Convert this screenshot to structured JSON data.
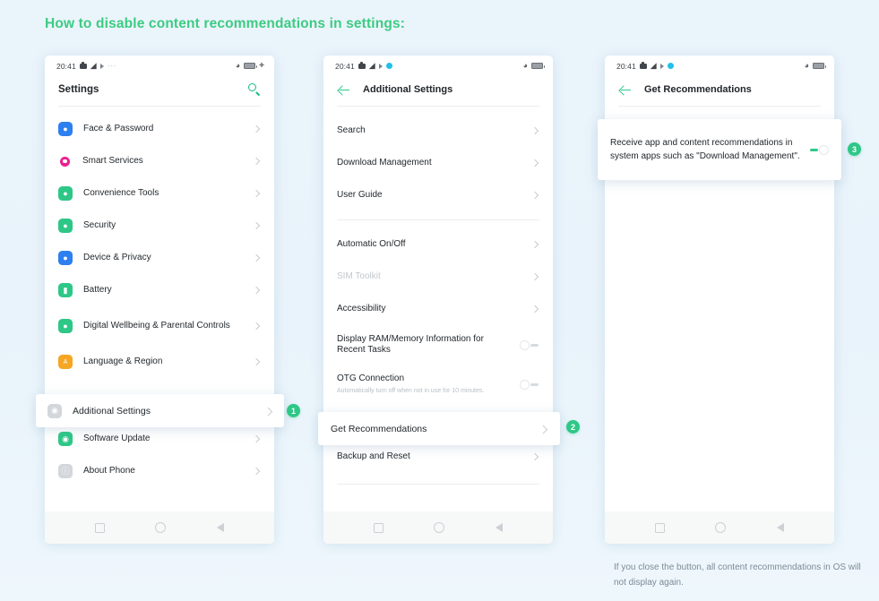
{
  "heading": "How to disable content recommendations in settings:",
  "colors": {
    "accent_green": "#3dcb82",
    "badge_green": "#2ec787",
    "background": "#eaf4fb",
    "toggle_on": "#2fc98c"
  },
  "phones": [
    {
      "id": "settings",
      "statusbar": {
        "time": "20:41",
        "icons_left": [
          "camera-icon",
          "wifi-icon",
          "play-icon",
          "dots-icon"
        ],
        "icons_right": [
          "vibrate-icon",
          "battery-icon",
          "plus-icon"
        ]
      },
      "appbar": {
        "title": "Settings",
        "has_back": false,
        "search_icon": "search-icon"
      },
      "rows": [
        {
          "label": "Face & Password",
          "icon": "face-password-icon",
          "icon_color": "#2e7ff0",
          "glyph": "●",
          "type": "chevron"
        },
        {
          "label": "Smart Services",
          "icon": "smart-services-icon",
          "icon_color": "#e8218f",
          "glyph": "",
          "type": "chevron",
          "shape": "circle"
        },
        {
          "label": "Convenience Tools",
          "icon": "convenience-tools-icon",
          "icon_color": "#2ec787",
          "glyph": "●",
          "type": "chevron"
        },
        {
          "label": "Security",
          "icon": "security-icon",
          "icon_color": "#2ec787",
          "glyph": "●",
          "type": "chevron"
        },
        {
          "label": "Device & Privacy",
          "icon": "device-privacy-icon",
          "icon_color": "#2e7ff0",
          "glyph": "●",
          "type": "chevron"
        },
        {
          "label": "Battery",
          "icon": "battery-icon",
          "icon_color": "#2ec787",
          "glyph": "●",
          "type": "chevron"
        },
        {
          "label": "Digital Wellbeing & Parental Controls",
          "icon": "digital-wellbeing-icon",
          "icon_color": "#2ec787",
          "glyph": "●",
          "type": "chevron",
          "tall": true
        },
        {
          "label": "Language & Region",
          "icon": "language-region-icon",
          "icon_color": "#f5a623",
          "glyph": "A",
          "type": "chevron"
        },
        {
          "label": "Software Update",
          "icon": "software-update-icon",
          "icon_color": "#2ec787",
          "glyph": "●",
          "type": "chevron"
        },
        {
          "label": "About Phone",
          "icon": "about-phone-icon",
          "icon_color": "#d3d7db",
          "glyph": "●",
          "type": "chevron"
        }
      ]
    },
    {
      "id": "additional-settings",
      "statusbar": {
        "time": "20:41"
      },
      "appbar": {
        "title": "Additional Settings",
        "has_back": true
      },
      "rows": [
        {
          "label": "Search",
          "type": "chevron"
        },
        {
          "label": "Download Management",
          "type": "chevron"
        },
        {
          "label": "User Guide",
          "type": "chevron"
        },
        {
          "label": "Automatic On/Off",
          "type": "chevron"
        },
        {
          "label": "SIM Toolkit",
          "type": "chevron",
          "dim": true
        },
        {
          "label": "Accessibility",
          "type": "chevron"
        },
        {
          "label": "Display RAM/Memory Information for Recent Tasks",
          "type": "switch",
          "switch_on": false
        },
        {
          "label": "OTG Connection",
          "sublabel": "Automatically turn off when not in use for 10 minutes.",
          "type": "switch",
          "switch_on": false
        },
        {
          "label": "Backup and Reset",
          "type": "chevron"
        }
      ]
    },
    {
      "id": "get-recommendations",
      "statusbar": {
        "time": "20:41"
      },
      "appbar": {
        "title": "Get Recommendations",
        "has_back": true
      },
      "rows": []
    }
  ],
  "highlights": [
    {
      "id": "hl1",
      "label": "Additional Settings",
      "icon": "additional-settings-icon",
      "icon_color": "#d3d7db",
      "badge": "1"
    },
    {
      "id": "hl2",
      "label": "Get Recommendations",
      "badge": "2"
    },
    {
      "id": "hl3",
      "label": "Receive app and content recommendations in system apps such as \"Download Management\".",
      "switch_on": true,
      "badge": "3"
    }
  ],
  "badges": {
    "one": "1",
    "two": "2",
    "three": "3"
  },
  "footnote": "If you close the button, all content recommendations in OS will not display again."
}
